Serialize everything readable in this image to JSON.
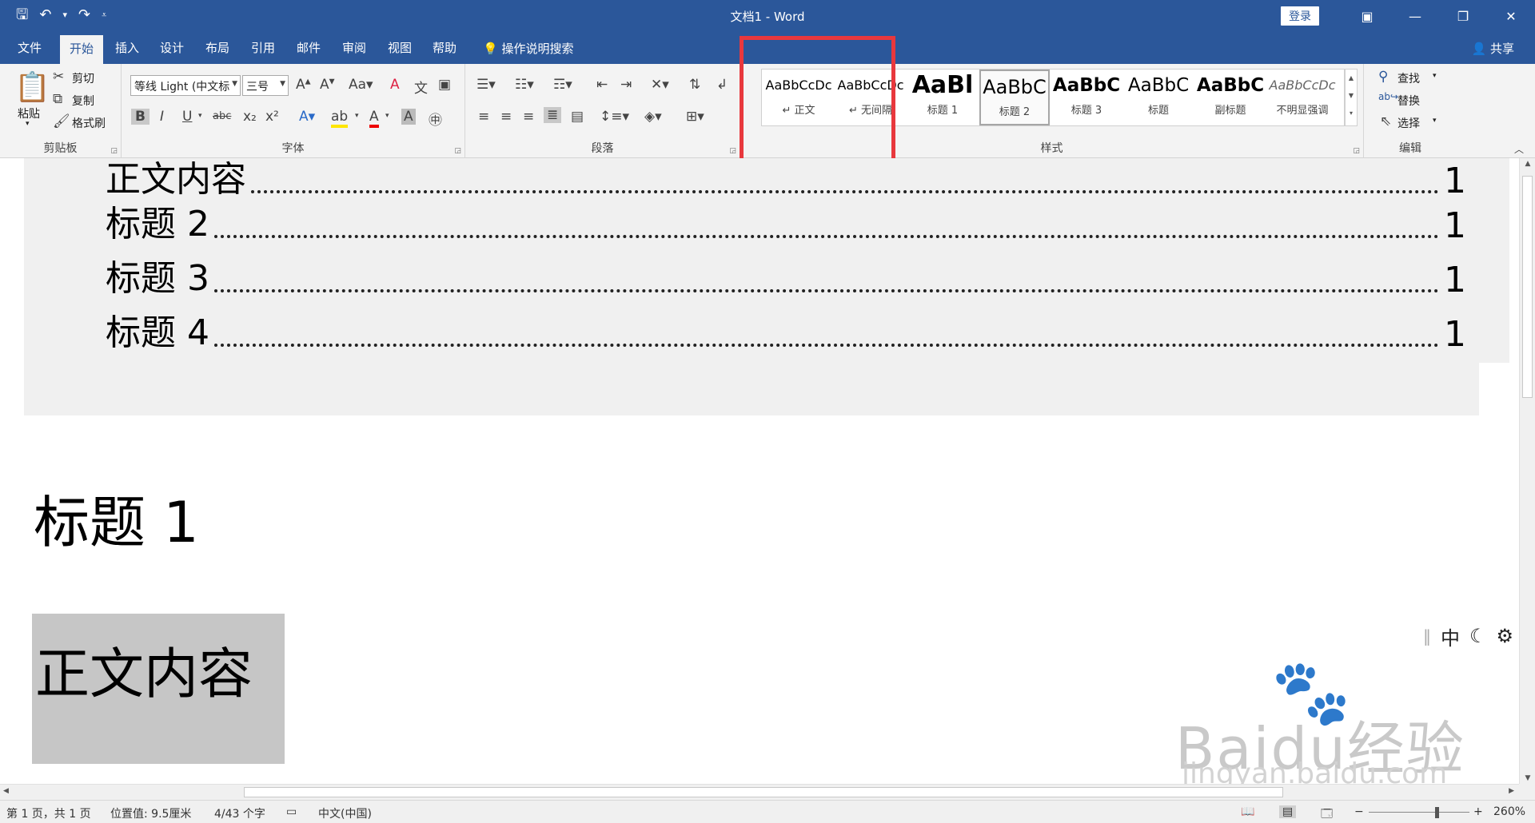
{
  "titlebar": {
    "title": "文档1 - Word",
    "login": "登录",
    "qat": {
      "save": "save-icon",
      "undo": "undo-icon",
      "redo": "redo-icon",
      "customize": "customize-icon"
    }
  },
  "tabs": [
    "文件",
    "开始",
    "插入",
    "设计",
    "布局",
    "引用",
    "邮件",
    "审阅",
    "视图",
    "帮助"
  ],
  "active_tab": "开始",
  "tell_me": "操作说明搜索",
  "share": "共享",
  "ribbon": {
    "clipboard": {
      "paste": "粘贴",
      "cut": "剪切",
      "copy": "复制",
      "format_painter": "格式刷",
      "label": "剪贴板"
    },
    "font": {
      "name": "等线 Light (中文标",
      "size": "三号",
      "label": "字体"
    },
    "paragraph": {
      "label": "段落"
    },
    "styles": {
      "label": "样式",
      "items": [
        {
          "preview": "AaBbCcDc",
          "name": "↵ 正文"
        },
        {
          "preview": "AaBbCcDc",
          "name": "↵ 无间隔"
        },
        {
          "preview": "AaBl",
          "name": "标题 1"
        },
        {
          "preview": "AaBbC",
          "name": "标题 2"
        },
        {
          "preview": "AaBbC",
          "name": "标题 3"
        },
        {
          "preview": "AaBbC",
          "name": "标题"
        },
        {
          "preview": "AaBbC",
          "name": "副标题"
        },
        {
          "preview": "AaBbCcDc",
          "name": "不明显强调"
        }
      ]
    },
    "editing": {
      "find": "查找",
      "replace": "替换",
      "select": "选择",
      "label": "编辑"
    }
  },
  "document": {
    "toc": [
      {
        "text": "正文内容",
        "page": "1"
      },
      {
        "text": "标题 2",
        "page": "1"
      },
      {
        "text": "标题 3",
        "page": "1"
      },
      {
        "text": "标题 4",
        "page": "1"
      }
    ],
    "heading1": "标题 1",
    "body": "正文内容"
  },
  "ime": {
    "lang": "中"
  },
  "watermark": {
    "brand": "Baidu经验",
    "url": "jingyan.baidu.com"
  },
  "status": {
    "page": "第 1 页，共 1 页",
    "position": "位置值: 9.5厘米",
    "words": "4/43 个字",
    "lang": "中文(中国)",
    "zoom": "260%",
    "zoom_fraction": 0.68
  },
  "colors": {
    "accent": "#2b579a",
    "highlight_box": "#e8383d",
    "selection": "#c6c6c6"
  }
}
